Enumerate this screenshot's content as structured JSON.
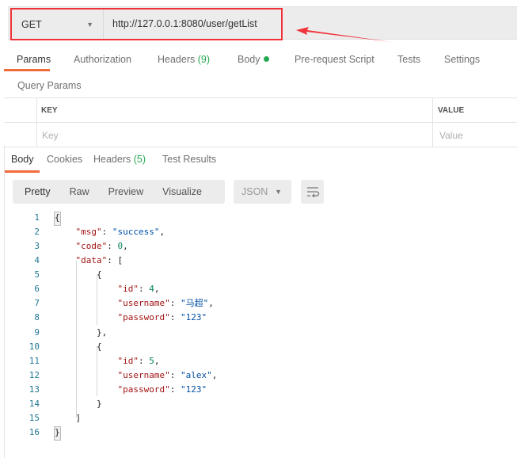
{
  "request": {
    "method": "GET",
    "url": "http://127.0.0.1:8080/user/getList"
  },
  "request_tabs": [
    {
      "label": "Params",
      "active": true
    },
    {
      "label": "Authorization"
    },
    {
      "label": "Headers",
      "count": "(9)"
    },
    {
      "label": "Body",
      "dot": true
    },
    {
      "label": "Pre-request Script"
    },
    {
      "label": "Tests"
    },
    {
      "label": "Settings"
    }
  ],
  "query_params": {
    "title": "Query Params",
    "key_header": "KEY",
    "value_header": "VALUE",
    "key_placeholder": "Key",
    "value_placeholder": "Value"
  },
  "response_tabs": [
    {
      "label": "Body",
      "active": true
    },
    {
      "label": "Cookies"
    },
    {
      "label": "Headers",
      "count": "(5)"
    },
    {
      "label": "Test Results"
    }
  ],
  "view_modes": [
    "Pretty",
    "Raw",
    "Preview",
    "Visualize"
  ],
  "selected_view": "Pretty",
  "format": "JSON",
  "code_lines": [
    [
      [
        "p",
        "{"
      ]
    ],
    [
      [
        "k",
        "    \"msg\""
      ],
      [
        "p",
        ": "
      ],
      [
        "s",
        "\"success\""
      ],
      [
        "p",
        ","
      ]
    ],
    [
      [
        "k",
        "    \"code\""
      ],
      [
        "p",
        ": "
      ],
      [
        "n",
        "0"
      ],
      [
        "p",
        ","
      ]
    ],
    [
      [
        "k",
        "    \"data\""
      ],
      [
        "p",
        ": ["
      ]
    ],
    [
      [
        "p",
        "        {"
      ]
    ],
    [
      [
        "k",
        "            \"id\""
      ],
      [
        "p",
        ": "
      ],
      [
        "n",
        "4"
      ],
      [
        "p",
        ","
      ]
    ],
    [
      [
        "k",
        "            \"username\""
      ],
      [
        "p",
        ": "
      ],
      [
        "s",
        "\"马超\""
      ],
      [
        "p",
        ","
      ]
    ],
    [
      [
        "k",
        "            \"password\""
      ],
      [
        "p",
        ": "
      ],
      [
        "s",
        "\"123\""
      ]
    ],
    [
      [
        "p",
        "        },"
      ]
    ],
    [
      [
        "p",
        "        {"
      ]
    ],
    [
      [
        "k",
        "            \"id\""
      ],
      [
        "p",
        ": "
      ],
      [
        "n",
        "5"
      ],
      [
        "p",
        ","
      ]
    ],
    [
      [
        "k",
        "            \"username\""
      ],
      [
        "p",
        ": "
      ],
      [
        "s",
        "\"alex\""
      ],
      [
        "p",
        ","
      ]
    ],
    [
      [
        "k",
        "            \"password\""
      ],
      [
        "p",
        ": "
      ],
      [
        "s",
        "\"123\""
      ]
    ],
    [
      [
        "p",
        "        }"
      ]
    ],
    [
      [
        "p",
        "    ]"
      ]
    ],
    [
      [
        "p",
        "}"
      ]
    ]
  ],
  "colors": {
    "accent": "#f26b3a",
    "annotation": "#f0333a",
    "count": "#26a853"
  }
}
